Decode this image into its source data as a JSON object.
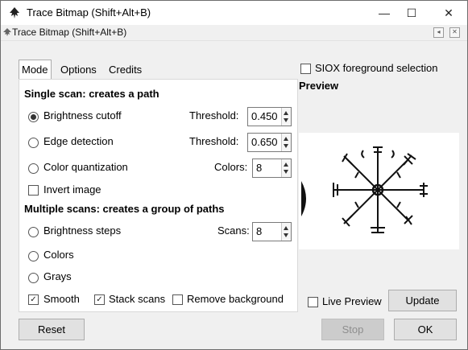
{
  "window": {
    "title": "Trace Bitmap (Shift+Alt+B)",
    "minimize_glyph": "—",
    "maximize_glyph": "☐",
    "close_glyph": "✕"
  },
  "dock": {
    "title": "Trace Bitmap (Shift+Alt+B)",
    "icons": [
      "dock-prev-icon",
      "dock-close-icon"
    ]
  },
  "tabs": [
    {
      "label": "Mode",
      "active": true
    },
    {
      "label": "Options",
      "active": false
    },
    {
      "label": "Credits",
      "active": false
    }
  ],
  "single_scan": {
    "heading": "Single scan: creates a path",
    "brightness_label": "Brightness cutoff",
    "brightness_threshold_label": "Threshold:",
    "brightness_threshold_value": "0.450",
    "edge_label": "Edge detection",
    "edge_threshold_label": "Threshold:",
    "edge_threshold_value": "0.650",
    "color_quant_label": "Color quantization",
    "colors_label": "Colors:",
    "colors_value": "8",
    "invert_label": "Invert image",
    "selected": "brightness"
  },
  "multi_scan": {
    "heading": "Multiple scans: creates a group of paths",
    "brightness_steps_label": "Brightness steps",
    "scans_label": "Scans:",
    "scans_value": "8",
    "colors_label": "Colors",
    "grays_label": "Grays",
    "smooth_label": "Smooth",
    "smooth_checked": true,
    "stack_label": "Stack scans",
    "stack_checked": true,
    "remove_bg_label": "Remove background",
    "remove_bg_checked": false
  },
  "siox": {
    "label": "SIOX foreground selection",
    "checked": false
  },
  "preview": {
    "heading": "Preview",
    "live_label": "Live Preview",
    "live_checked": false,
    "update_label": "Update"
  },
  "buttons": {
    "reset": "Reset",
    "stop": "Stop",
    "ok": "OK"
  },
  "icons": {
    "app": "inkscape-icon",
    "dock": "inkscape-small-icon"
  }
}
